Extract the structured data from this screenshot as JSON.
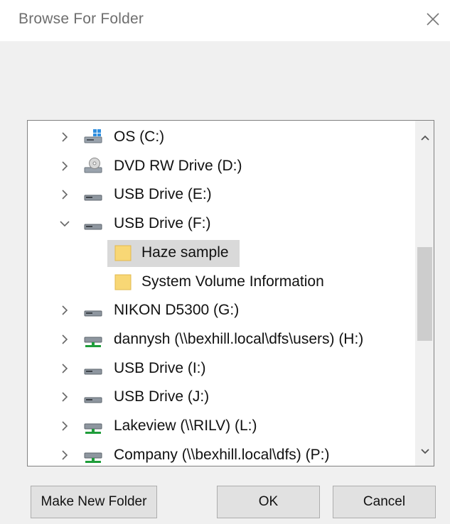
{
  "dialog": {
    "title": "Browse For Folder",
    "instruction": ""
  },
  "tree": {
    "items": [
      {
        "label": "OS (C:)",
        "icon": "os-drive-icon",
        "expander": "collapsed"
      },
      {
        "label": "DVD RW Drive (D:)",
        "icon": "dvd-drive-icon",
        "expander": "collapsed"
      },
      {
        "label": "USB Drive (E:)",
        "icon": "usb-drive-icon",
        "expander": "collapsed"
      },
      {
        "label": "USB Drive (F:)",
        "icon": "usb-drive-icon",
        "expander": "expanded"
      },
      {
        "label": "Haze sample",
        "icon": "folder-icon",
        "expander": "none",
        "selected": true
      },
      {
        "label": "System Volume Information",
        "icon": "folder-icon",
        "expander": "none"
      },
      {
        "label": "NIKON D5300 (G:)",
        "icon": "usb-drive-icon",
        "expander": "collapsed"
      },
      {
        "label": "dannysh (\\\\bexhill.local\\dfs\\users) (H:)",
        "icon": "network-drive-icon",
        "expander": "collapsed"
      },
      {
        "label": "USB Drive (I:)",
        "icon": "usb-drive-icon",
        "expander": "collapsed"
      },
      {
        "label": "USB Drive (J:)",
        "icon": "usb-drive-icon",
        "expander": "collapsed"
      },
      {
        "label": "Lakeview (\\\\RILV) (L:)",
        "icon": "network-drive-icon",
        "expander": "collapsed"
      },
      {
        "label": "Company (\\\\bexhill.local\\dfs) (P:)",
        "icon": "network-drive-icon",
        "expander": "collapsed"
      }
    ]
  },
  "buttons": {
    "make_new_folder": "Make New Folder",
    "ok": "OK",
    "cancel": "Cancel"
  },
  "colors": {
    "selection": "#d9d9d9",
    "folder": "#f8d775",
    "network_green": "#1f9d3a"
  }
}
